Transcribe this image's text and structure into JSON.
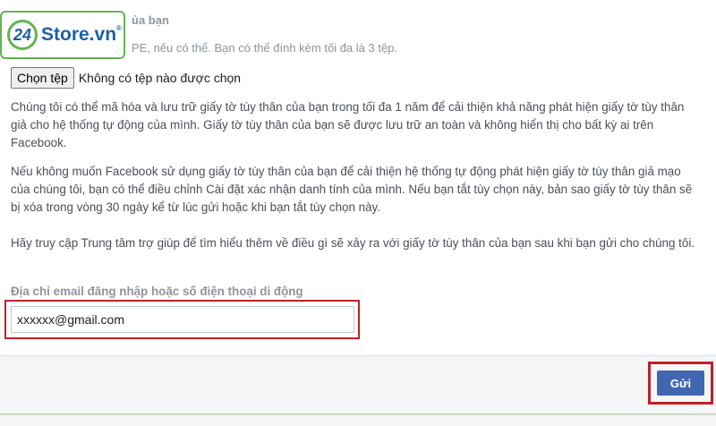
{
  "watermark": {
    "logo_number": "24",
    "logo_text": "Store.vn",
    "logo_mark": "®"
  },
  "form": {
    "section_heading_partial": "ủa bạn",
    "upload_hint_partial": "PE, nếu có thể. Bạn có thể đính kèm tối đa là 3 tệp.",
    "file_button_label": "Chọn tệp",
    "file_status": "Không có tệp nào được chọn",
    "paragraphs": [
      "Chúng tôi có thể mã hóa và lưu trữ giấy tờ tùy thân của bạn trong tối đa 1 năm để cải thiện khả năng phát hiện giấy tờ tùy thân giả cho hệ thống tự động của mình. Giấy tờ tùy thân của bạn sẽ được lưu trữ an toàn và không hiển thị cho bất kỳ ai trên Facebook.",
      "Nếu không muốn Facebook sử dụng giấy tờ tùy thân của bạn để cải thiện hệ thống tự động phát hiện giấy tờ tùy thân giả mạo của chúng tôi, bạn có thể điều chỉnh Cài đặt xác nhận danh tính của mình. Nếu bạn tắt tùy chọn này, bản sao giấy tờ tùy thân sẽ bị xóa trong vòng 30 ngày kể từ lúc gửi hoặc khi bạn tắt tùy chọn này.",
      "Hãy truy cập Trung tâm trợ giúp để tìm hiểu thêm về điều gì sẽ xảy ra với giấy tờ tùy thân của bạn sau khi bạn gửi cho chúng tôi."
    ],
    "email_label": "Địa chỉ email đăng nhập hoặc số điện thoại di động",
    "email_value": "xxxxxx@gmail.com",
    "submit_label": "Gửi"
  },
  "colors": {
    "accent": "#4267b2",
    "highlight": "#c0202a",
    "logo_green": "#62b552",
    "logo_blue": "#1f5fa8"
  }
}
